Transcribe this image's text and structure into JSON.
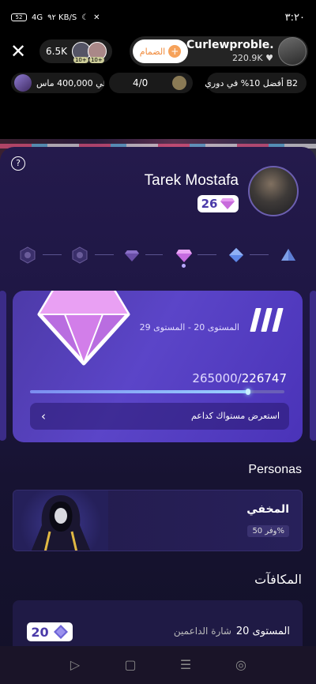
{
  "status_bar": {
    "time": "٣:٢٠",
    "battery": "52",
    "network": "4G",
    "speed": "٩٢ KB/S"
  },
  "live_header": {
    "close_icon": "close-icon",
    "viewers_count": "6.5K",
    "viewer_badges": [
      "10+",
      "10+"
    ],
    "join_label": "الضمام",
    "host_name": "Curlewproble...",
    "host_fans": "220.9K ♥"
  },
  "info_row": {
    "left_text": "لي 400,000 ماس",
    "mid_count": "4/0",
    "right_text": "أفضل 10% في دوري B2"
  },
  "profile": {
    "help_icon": "question-icon",
    "name": "Tarek Mostafa",
    "level": "26"
  },
  "level_card": {
    "range": "المستوى 20 - المستوى 29",
    "current_points": "226747",
    "target_points": "265000",
    "separator": "/",
    "progress": 0.856,
    "show_label": "استعرض مستواك كداعم"
  },
  "personas": {
    "title": "Personas",
    "item": {
      "name": "المخفي",
      "discount": "وفر 50%"
    }
  },
  "rewards": {
    "title": "المكافآت",
    "item": {
      "level": "المستوى 20",
      "badge_name": "شارة الداعمين",
      "chip_value": "20"
    }
  },
  "colors": {
    "accent": "#5b45c8",
    "sheet_bg": "#1d1642",
    "gem_pink": "#e07ae8"
  }
}
